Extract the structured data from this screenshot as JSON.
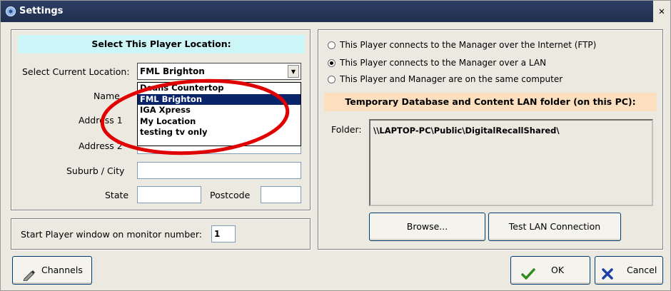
{
  "window": {
    "title": "Settings",
    "close_glyph": "✕"
  },
  "location_panel": {
    "header": "Select This Player Location:",
    "select_label": "Select Current Location:",
    "current_location": "FML Brighton",
    "options": [
      "Deans Countertop",
      "FML Brighton",
      "IGA Xpress",
      "My Location",
      "testing tv only"
    ],
    "selected_index": 1,
    "name_label": "Name",
    "address1_label": "Address 1",
    "address2_label": "Address 2",
    "suburb_label": "Suburb / City",
    "state_label": "State",
    "postcode_label": "Postcode",
    "name_value": "",
    "address1_value": "",
    "address2_value": "",
    "suburb_value": "",
    "state_value": "",
    "postcode_value": ""
  },
  "monitor_panel": {
    "label": "Start Player window on monitor number:",
    "value": "1"
  },
  "connection_panel": {
    "options": [
      "This Player connects to the Manager over the Internet (FTP)",
      "This Player connects to the Manager over a LAN",
      "This Player and Manager are on the same computer"
    ],
    "selected_index": 1,
    "lan_header": "Temporary Database and Content LAN folder (on this PC):",
    "folder_label": "Folder:",
    "folder_value": "\\\\LAPTOP-PC\\Public\\DigitalRecallShared\\",
    "browse_label": "Browse...",
    "test_label": "Test LAN Connection"
  },
  "footer": {
    "channels_label": "Channels",
    "ok_label": "OK",
    "cancel_label": "Cancel"
  },
  "colors": {
    "titlebar": "#1f2f50",
    "location_header_bg": "#ccf5f8",
    "lan_header_bg": "#fcdfbf",
    "selected_item_bg": "#0a246a",
    "annotation_ellipse": "#e00000",
    "ok_check": "#2e8b22",
    "cancel_x": "#1a3fa8"
  },
  "icons": {
    "window_icon": "settings-app-icon",
    "channels_icon": "pen-icon",
    "ok_icon": "checkmark-icon",
    "cancel_icon": "x-icon"
  }
}
